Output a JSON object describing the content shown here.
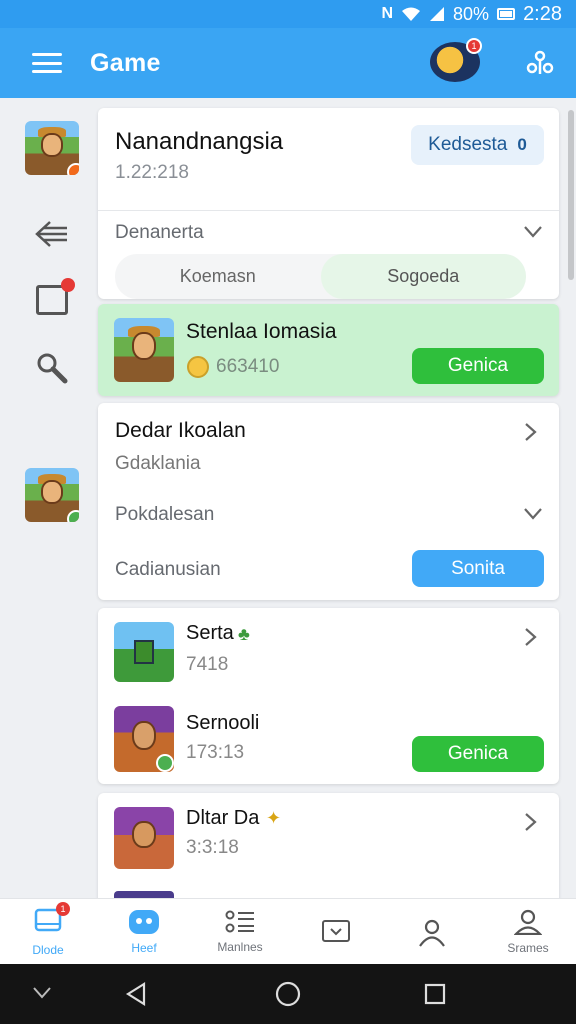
{
  "status_bar": {
    "network": "N",
    "battery": "80%",
    "time": "2:28"
  },
  "app_bar": {
    "title": "Game",
    "avatar_badge": "1"
  },
  "sidebar": {
    "items": [
      "game-thumbnail",
      "back-arrow-icon",
      "notification-icon",
      "search-icon",
      "game-thumbnail"
    ]
  },
  "card1": {
    "title": "Nanandnangsia",
    "subtitle": "1.22:218",
    "badge_label": "Kedsesta",
    "badge_count": "0",
    "row_label": "Denanerta",
    "segments": [
      "Koemasn",
      "Sogoeda"
    ]
  },
  "card2": {
    "title": "Stenlaa Iomasia",
    "value": "663410",
    "button": "Genica"
  },
  "card3": {
    "title": "Dedar Ikoalan",
    "subtitle": "Gdaklania",
    "row1": "Pokdalesan",
    "row2": "Cadianusian",
    "button": "Sonita"
  },
  "card4": {
    "items": [
      {
        "title": "Serta",
        "meta": "7418"
      },
      {
        "title": "Sernooli",
        "meta": "173:13",
        "button": "Genica"
      }
    ]
  },
  "card5": {
    "title": "Dltar Da",
    "meta": "3:3:18"
  },
  "bottom_nav": [
    {
      "label": "Dlode",
      "badge": "1"
    },
    {
      "label": "Heef"
    },
    {
      "label": "Manlnes"
    },
    {
      "label": ""
    },
    {
      "label": ""
    },
    {
      "label": "Srames"
    }
  ],
  "colors": {
    "primary": "#3aa5f3",
    "green": "#2fbf3c",
    "blue_button": "#41a9f7",
    "highlight": "#c9f2d0"
  }
}
